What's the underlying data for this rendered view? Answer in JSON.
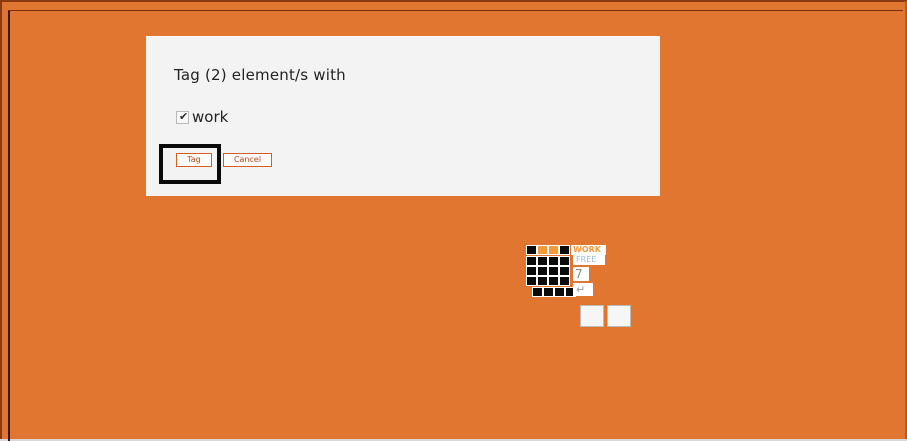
{
  "dialog": {
    "title": "Tag (2) element/s with",
    "tag_options": [
      {
        "label": "work",
        "checked": true,
        "check_glyph": "✔"
      }
    ],
    "buttons": {
      "tag_label": "Tag",
      "cancel_label": "Cancel"
    }
  },
  "minimap": {
    "tags": [
      {
        "label": "WORK",
        "color": "#f39b3a"
      },
      {
        "label": "FREE",
        "color": "#9dbad8"
      },
      {
        "label": "7",
        "color": "#888888"
      },
      {
        "label": "↵",
        "color": "#999999"
      }
    ]
  },
  "colors": {
    "background": "#e07630",
    "dialog_background": "#f3f3f3",
    "button_accent": "#d55e24",
    "selected_square": "#0b0b0b",
    "orange_square": "#f39b3a"
  },
  "icons": {
    "checkbox": "check-icon",
    "arrow": "return-arrow-icon"
  }
}
